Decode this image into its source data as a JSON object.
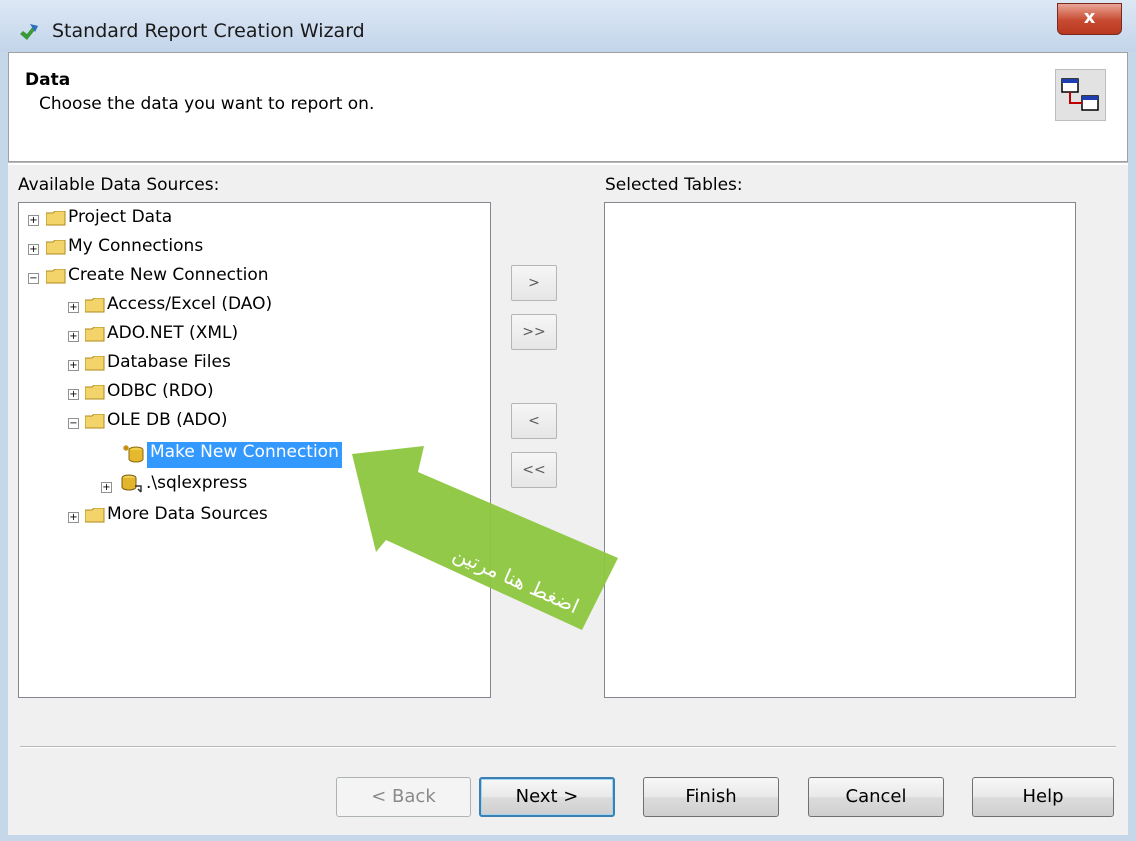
{
  "window": {
    "title": "Standard Report Creation Wizard",
    "close_label": "x"
  },
  "header": {
    "title": "Data",
    "subtitle": "Choose the data you want to report on."
  },
  "available": {
    "label": "Available Data Sources:",
    "items": [
      {
        "label": "Project Data",
        "expander": "+",
        "icon": "folder-icon"
      },
      {
        "label": "My Connections",
        "expander": "+",
        "icon": "folder-icon"
      },
      {
        "label": "Create New Connection",
        "expander": "−",
        "icon": "folder-icon"
      },
      {
        "label": "Access/Excel (DAO)",
        "expander": "+",
        "icon": "folder-icon"
      },
      {
        "label": "ADO.NET (XML)",
        "expander": "+",
        "icon": "folder-icon"
      },
      {
        "label": "Database Files",
        "expander": "+",
        "icon": "folder-icon"
      },
      {
        "label": "ODBC (RDO)",
        "expander": "+",
        "icon": "folder-icon"
      },
      {
        "label": "OLE DB (ADO)",
        "expander": "−",
        "icon": "folder-icon"
      },
      {
        "label": "Make New Connection",
        "expander": "",
        "icon": "new-connection-icon",
        "selected": true
      },
      {
        "label": ".\\sqlexpress",
        "expander": "+",
        "icon": "database-server-icon"
      },
      {
        "label": "More Data Sources",
        "expander": "+",
        "icon": "folder-icon"
      }
    ]
  },
  "selected_tables": {
    "label": "Selected Tables:"
  },
  "transfer_buttons": {
    "add": ">",
    "add_all": ">>",
    "remove": "<",
    "remove_all": "<<"
  },
  "annotation": {
    "text": "اضغط هنا مرتين",
    "color": "#8dc63f"
  },
  "footer": {
    "back": "< Back",
    "next": "Next >",
    "finish": "Finish",
    "cancel": "Cancel",
    "help": "Help"
  }
}
